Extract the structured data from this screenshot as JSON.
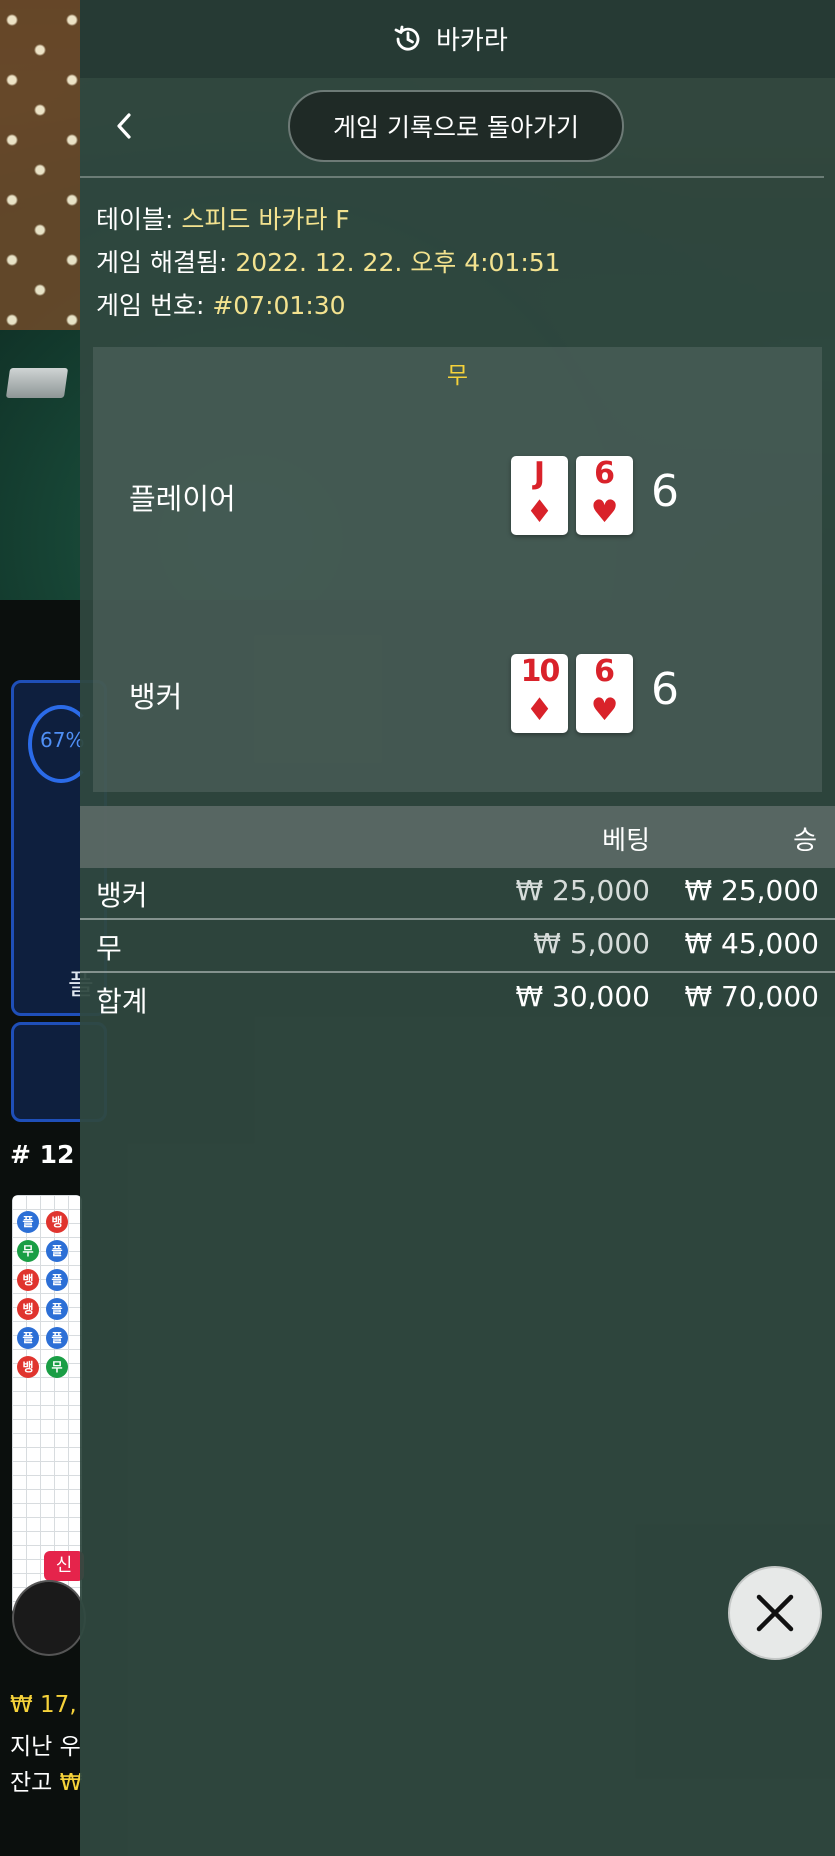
{
  "header": {
    "title": "바카라"
  },
  "back_to_history_label": "게임 기록으로 돌아가기",
  "info": {
    "table_label": "테이블: ",
    "table_value": "스피드 바카라 F",
    "resolved_label": "게임 해결됨: ",
    "resolved_value": "2022. 12. 22. 오후 4:01:51",
    "game_no_label": "게임 번호: ",
    "game_no_value": "#07:01:30"
  },
  "result": {
    "outcome": "무",
    "player": {
      "label": "플레이어",
      "cards": [
        {
          "rank": "J",
          "suit": "♦"
        },
        {
          "rank": "6",
          "suit": "♥"
        }
      ],
      "score": "6"
    },
    "banker": {
      "label": "뱅커",
      "cards": [
        {
          "rank": "10",
          "suit": "♦"
        },
        {
          "rank": "6",
          "suit": "♥"
        }
      ],
      "score": "6"
    }
  },
  "bets_table": {
    "headers": {
      "bet": "베팅",
      "win": "승"
    },
    "rows": [
      {
        "label": "뱅커",
        "bet": "₩ 25,000",
        "win": "₩ 25,000"
      },
      {
        "label": "무",
        "bet": "₩ 5,000",
        "win": "₩ 45,000"
      }
    ],
    "total": {
      "label": "합계",
      "bet": "₩ 30,000",
      "win": "₩ 70,000"
    }
  },
  "background": {
    "percent": "67%",
    "bet_char": "플",
    "round": "# 12",
    "new_badge": "신",
    "bet_amount": "₩ 17,",
    "last_win_label": "지난 우",
    "balance_label": "잔고 ",
    "balance_currency": "₩",
    "roadmap": [
      "플",
      "뱅",
      "무",
      "플",
      "뱅",
      "플",
      "뱅",
      "플",
      "플",
      "플",
      "뱅",
      "무"
    ]
  },
  "colors": {
    "accent_yellow": "#f6d23a",
    "card_red": "#d9222a",
    "panel": "#30483f"
  }
}
